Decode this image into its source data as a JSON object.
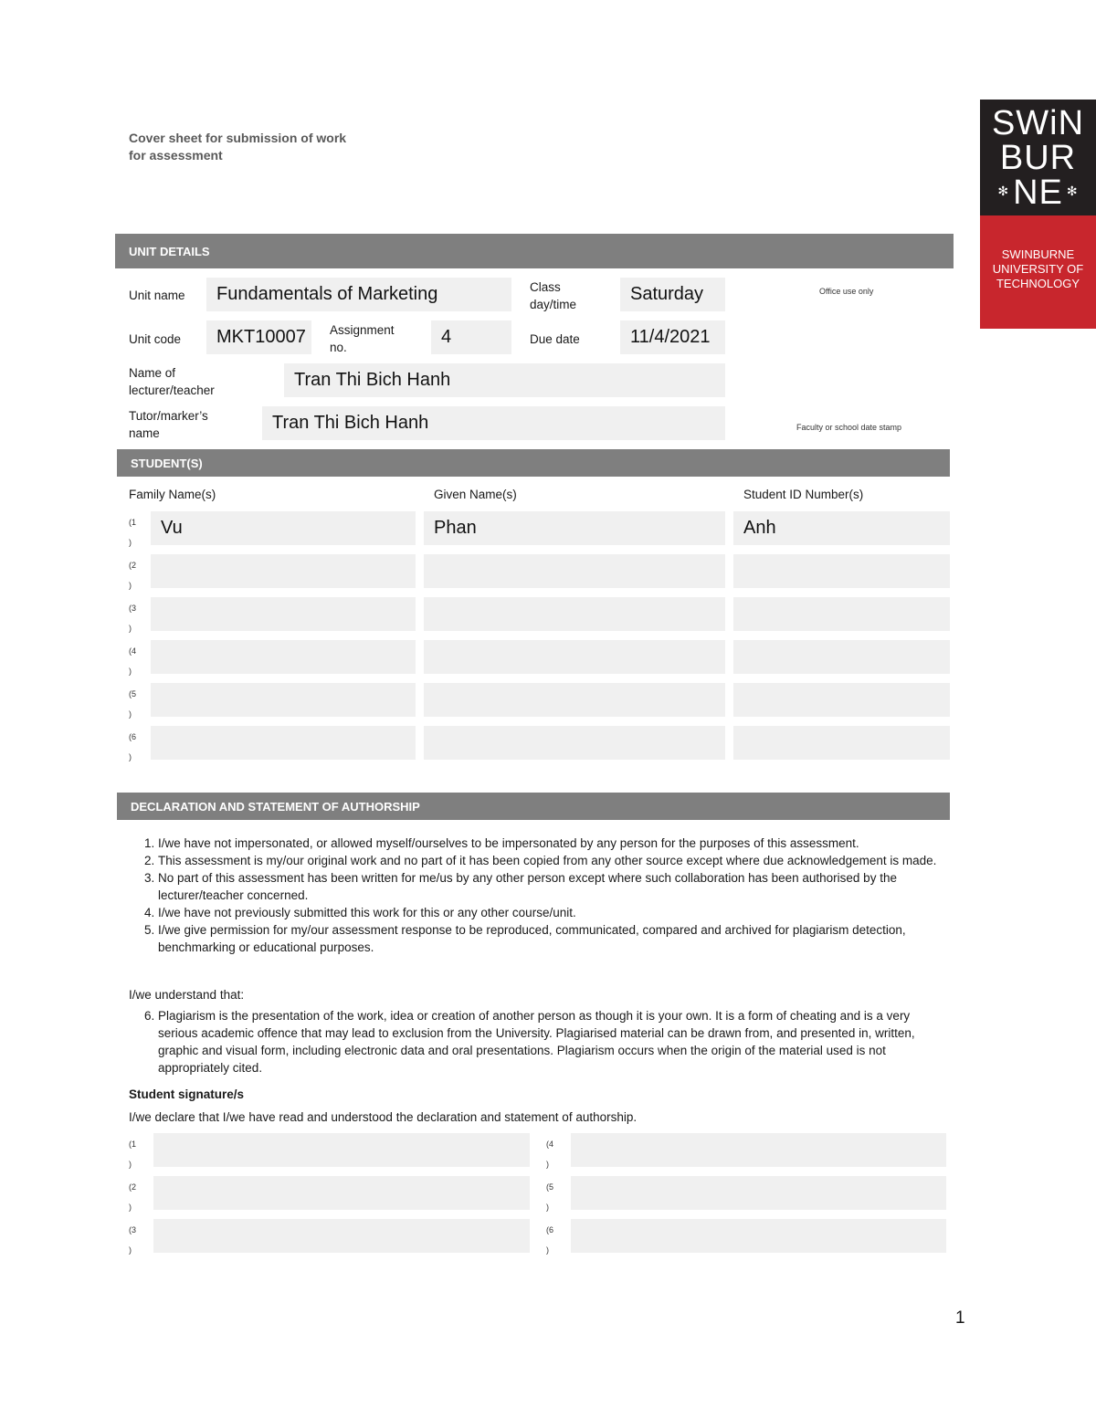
{
  "document": {
    "title": "Cover sheet for submission of work for assessment",
    "page_number": "1"
  },
  "logo": {
    "mark_lines": [
      "SWiN",
      "BUR",
      "NE"
    ],
    "flower_glyph": "✻",
    "institution_lines": [
      "SWINBURNE",
      "UNIVERSITY OF",
      "TECHNOLOGY"
    ],
    "colors": {
      "top": "#231f20",
      "bottom": "#c8262d"
    }
  },
  "unit_details": {
    "header": "UNIT DETAILS",
    "unit_name_label": "Unit name",
    "unit_name": "Fundamentals of Marketing",
    "class_label": "Class day/time",
    "class_value": "Saturday",
    "unit_code_label": "Unit code",
    "unit_code": "MKT10007",
    "assignment_label": "Assignment no.",
    "assignment_no": "4",
    "due_date_label": "Due date",
    "due_date": "11/4/2021",
    "lecturer_label": "Name of lecturer/teacher",
    "lecturer": "Tran Thi Bich Hanh",
    "tutor_label": "Tutor/marker’s name",
    "tutor": "Tran Thi Bich Hanh",
    "office_use_label": "Office use only",
    "date_stamp_label": "Faculty or school date stamp"
  },
  "students": {
    "header": "STUDENT(S)",
    "columns": [
      "Family Name(s)",
      "Given Name(s)",
      "Student ID Number(s)"
    ],
    "rows": [
      {
        "num": "(1",
        "close": ")",
        "family": "Vu",
        "given": "Phan",
        "id": "Anh"
      },
      {
        "num": "(2",
        "close": ")",
        "family": "",
        "given": "",
        "id": ""
      },
      {
        "num": "(3",
        "close": ")",
        "family": "",
        "given": "",
        "id": ""
      },
      {
        "num": "(4",
        "close": ")",
        "family": "",
        "given": "",
        "id": ""
      },
      {
        "num": "(5",
        "close": ")",
        "family": "",
        "given": "",
        "id": ""
      },
      {
        "num": "(6",
        "close": ")",
        "family": "",
        "given": "",
        "id": ""
      }
    ]
  },
  "declaration": {
    "header": "DECLARATION AND STATEMENT OF AUTHORSHIP",
    "items": [
      "I/we have not impersonated, or allowed myself/ourselves to be impersonated by any person for the purposes of this assessment.",
      "This assessment is my/our original work and no part of it has been copied from any other source except where due acknowledgement is made.",
      "No part of this assessment has been written for me/us by any other person except where such collaboration has been authorised by the lecturer/teacher concerned.",
      "I/we have not previously submitted this work for this or any other course/unit.",
      "I/we  give permission for my/our assessment response to be reproduced, communicated, compared and archived for plagiarism detection, benchmarking or educational purposes."
    ],
    "understand_label": "I/we understand that:",
    "item6": "Plagiarism is the presentation of the work, idea or creation of another person as though it is your own. It is a form of cheating and is a very serious academic offence that may lead to exclusion from the University. Plagiarised material can be drawn from, and presented in, written, graphic and visual form, including electronic data and oral presentations. Plagiarism occurs when the origin of the material used is not appropriately cited."
  },
  "signatures": {
    "header": "Student signature/s",
    "statement": "I/we declare that I/we have read and understood the declaration and statement of authorship.",
    "slots": [
      {
        "num": "(1",
        "close": ")",
        "value": ""
      },
      {
        "num": "(2",
        "close": ")",
        "value": ""
      },
      {
        "num": "(3",
        "close": ")",
        "value": ""
      },
      {
        "num": "(4",
        "close": ")",
        "value": ""
      },
      {
        "num": "(5",
        "close": ")",
        "value": ""
      },
      {
        "num": "(6",
        "close": ")",
        "value": ""
      }
    ]
  }
}
